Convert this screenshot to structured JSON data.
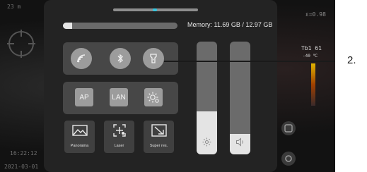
{
  "background": {
    "top_left_text": "23 m",
    "top_right_text": "ε=0.98",
    "right_temp_text": "Tb1 61",
    "right_temp_sub": "-40 ℃",
    "time_text": "16:22:12",
    "date_text": "2021-03-01"
  },
  "memory": {
    "label": "Memory: 11.69 GB / 12.97 GB",
    "used_fraction": 0.08
  },
  "connectivity": {
    "wifi_icon": "wifi-icon",
    "bluetooth_icon": "bluetooth-icon",
    "flashlight_icon": "flashlight-icon"
  },
  "network": {
    "ap_label": "AP",
    "lan_label": "LAN",
    "display_icon": "brightness-settings-icon"
  },
  "modes": {
    "panorama_label": "Panorama",
    "laser_label": "Laser",
    "super_res_label": "Super res."
  },
  "sliders": {
    "brightness_level": 0.38,
    "volume_level": 0.18
  },
  "callout": {
    "label": "2."
  },
  "colors": {
    "accent": "#36c7e0"
  }
}
